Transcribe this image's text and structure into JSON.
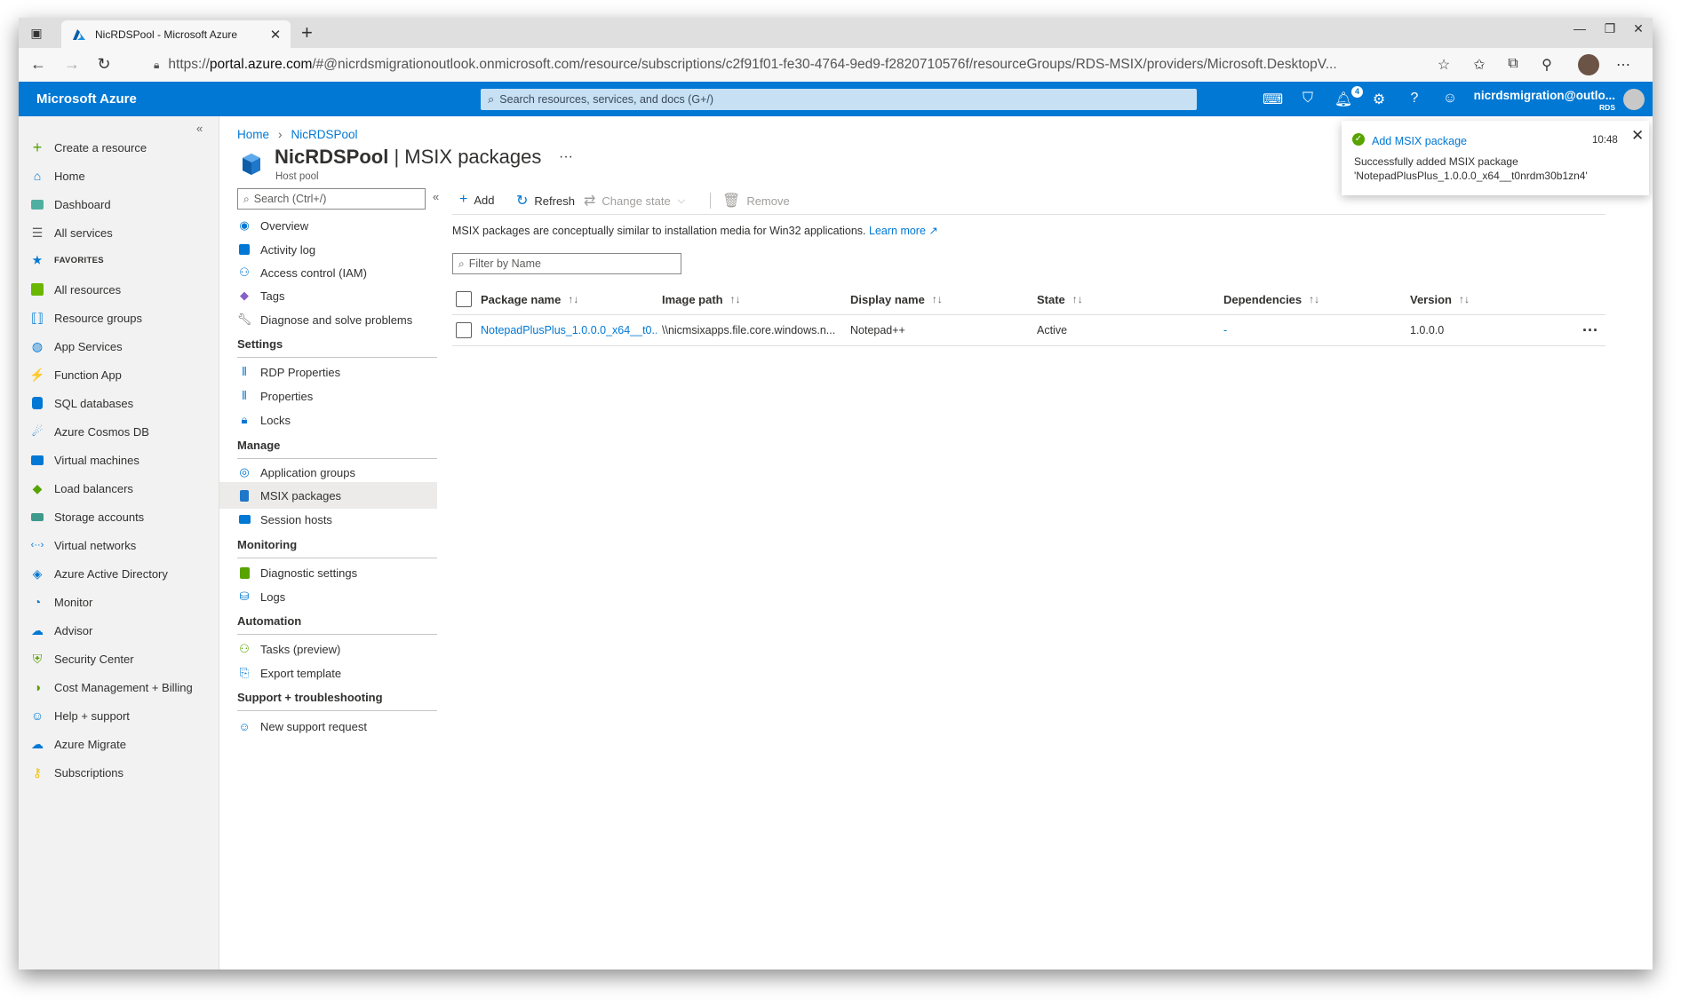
{
  "browser": {
    "tab_title": "NicRDSPool - Microsoft Azure",
    "url_prefix": "https://",
    "url_host": "portal.azure.com",
    "url_rest": "/#@nicrdsmigrationoutlook.onmicrosoft.com/resource/subscriptions/c2f91f01-fe30-4764-9ed9-f2820710576f/resourceGroups/RDS-MSIX/providers/Microsoft.DesktopV..."
  },
  "portal": {
    "brand": "Microsoft Azure",
    "search_placeholder": "Search resources, services, and docs (G+/)",
    "notification_count": "4",
    "account_name": "nicrdsmigration@outlo...",
    "account_tenant": "RDS"
  },
  "leftnav": {
    "create": "Create a resource",
    "home": "Home",
    "dashboard": "Dashboard",
    "all_services": "All services",
    "favorites_header": "FAVORITES",
    "items": [
      "All resources",
      "Resource groups",
      "App Services",
      "Function App",
      "SQL databases",
      "Azure Cosmos DB",
      "Virtual machines",
      "Load balancers",
      "Storage accounts",
      "Virtual networks",
      "Azure Active Directory",
      "Monitor",
      "Advisor",
      "Security Center",
      "Cost Management + Billing",
      "Help + support",
      "Azure Migrate",
      "Subscriptions"
    ]
  },
  "breadcrumb": {
    "home": "Home",
    "resource": "NicRDSPool"
  },
  "page": {
    "title_name": "NicRDSPool",
    "title_section": " | MSIX packages",
    "subtitle": "Host pool"
  },
  "resource_menu": {
    "search_placeholder": "Search (Ctrl+/)",
    "top": [
      "Overview",
      "Activity log",
      "Access control (IAM)",
      "Tags",
      "Diagnose and solve problems"
    ],
    "sections": {
      "settings": "Settings",
      "manage": "Manage",
      "monitoring": "Monitoring",
      "automation": "Automation",
      "support": "Support + troubleshooting"
    },
    "settings": [
      "RDP Properties",
      "Properties",
      "Locks"
    ],
    "manage": [
      "Application groups",
      "MSIX packages",
      "Session hosts"
    ],
    "monitoring": [
      "Diagnostic settings",
      "Logs"
    ],
    "automation": [
      "Tasks (preview)",
      "Export template"
    ],
    "support": [
      "New support request"
    ]
  },
  "toolbar": {
    "add": "Add",
    "refresh": "Refresh",
    "change_state": "Change state",
    "remove": "Remove"
  },
  "content": {
    "description": "MSIX packages are conceptually similar to installation media for Win32 applications.",
    "learn_more": "Learn more",
    "filter_placeholder": "Filter by Name"
  },
  "table": {
    "headers": [
      "Package name",
      "Image path",
      "Display name",
      "State",
      "Dependencies",
      "Version"
    ],
    "rows": [
      {
        "package_name": "NotepadPlusPlus_1.0.0.0_x64__t0...",
        "image_path": "\\\\nicmsixapps.file.core.windows.n...",
        "display_name": "Notepad++",
        "state": "Active",
        "dependencies": "-",
        "version": "1.0.0.0"
      }
    ]
  },
  "toast": {
    "title": "Add MSIX package",
    "time": "10:48",
    "message_line1": "Successfully added MSIX package",
    "message_line2": "'NotepadPlusPlus_1.0.0.0_x64__t0nrdm30b1zn4'"
  },
  "colors": {
    "azure_blue": "#0078d4",
    "success_green": "#57a300"
  }
}
